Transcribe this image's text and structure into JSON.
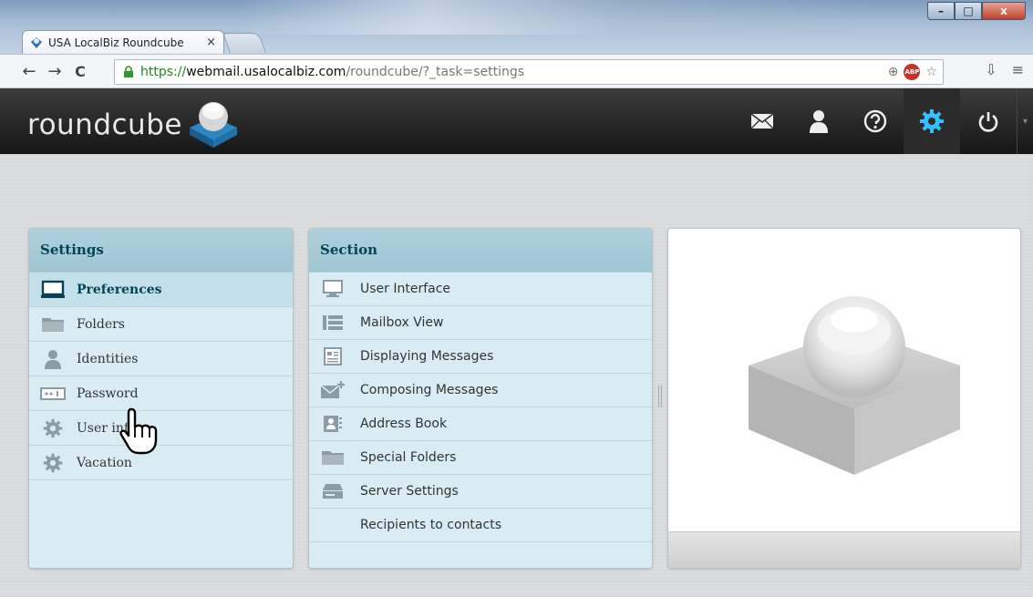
{
  "browser": {
    "tab_title": "USA LocalBiz Roundcube",
    "tab_close": "×",
    "url_scheme": "https://",
    "url_host": "webmail.usalocalbiz.com",
    "url_path": "/roundcube/?_task=settings",
    "back": "←",
    "forward": "→",
    "reload": "C",
    "win_min": "–",
    "win_max": "□",
    "win_close": "x",
    "abp_label": "ABP",
    "zoom_icon": "⊕",
    "star_icon": "☆",
    "menu_icon": "≡",
    "download_icon": "⇩"
  },
  "app": {
    "logo_text": "roundcube",
    "nav": [
      {
        "name": "mail",
        "icon": "envelope-icon"
      },
      {
        "name": "contacts",
        "icon": "person-icon"
      },
      {
        "name": "help",
        "icon": "question-icon"
      },
      {
        "name": "settings",
        "icon": "gear-icon",
        "active": true
      },
      {
        "name": "logout",
        "icon": "power-icon"
      }
    ],
    "nav_more": "▾"
  },
  "settings_panel": {
    "title": "Settings",
    "items": [
      {
        "label": "Preferences",
        "icon": "monitor-icon",
        "selected": true
      },
      {
        "label": "Folders",
        "icon": "folder-icon"
      },
      {
        "label": "Identities",
        "icon": "person-icon"
      },
      {
        "label": "Password",
        "icon": "password-icon"
      },
      {
        "label": "User info",
        "icon": "gear-icon"
      },
      {
        "label": "Vacation",
        "icon": "gear-icon"
      }
    ]
  },
  "section_panel": {
    "title": "Section",
    "items": [
      {
        "label": "User Interface",
        "icon": "monitor-icon"
      },
      {
        "label": "Mailbox View",
        "icon": "list-view-icon"
      },
      {
        "label": "Displaying Messages",
        "icon": "message-icon"
      },
      {
        "label": "Composing Messages",
        "icon": "compose-icon"
      },
      {
        "label": "Address Book",
        "icon": "addressbook-icon"
      },
      {
        "label": "Special Folders",
        "icon": "folder-icon"
      },
      {
        "label": "Server Settings",
        "icon": "server-icon"
      },
      {
        "label": "Recipients to contacts",
        "icon": ""
      }
    ]
  },
  "colors": {
    "header_bg": "#1f1f1f",
    "panel_bg": "#d9ecf3",
    "panel_header": "#a9cfdb",
    "accent": "#37beff",
    "title_text": "#004458"
  }
}
